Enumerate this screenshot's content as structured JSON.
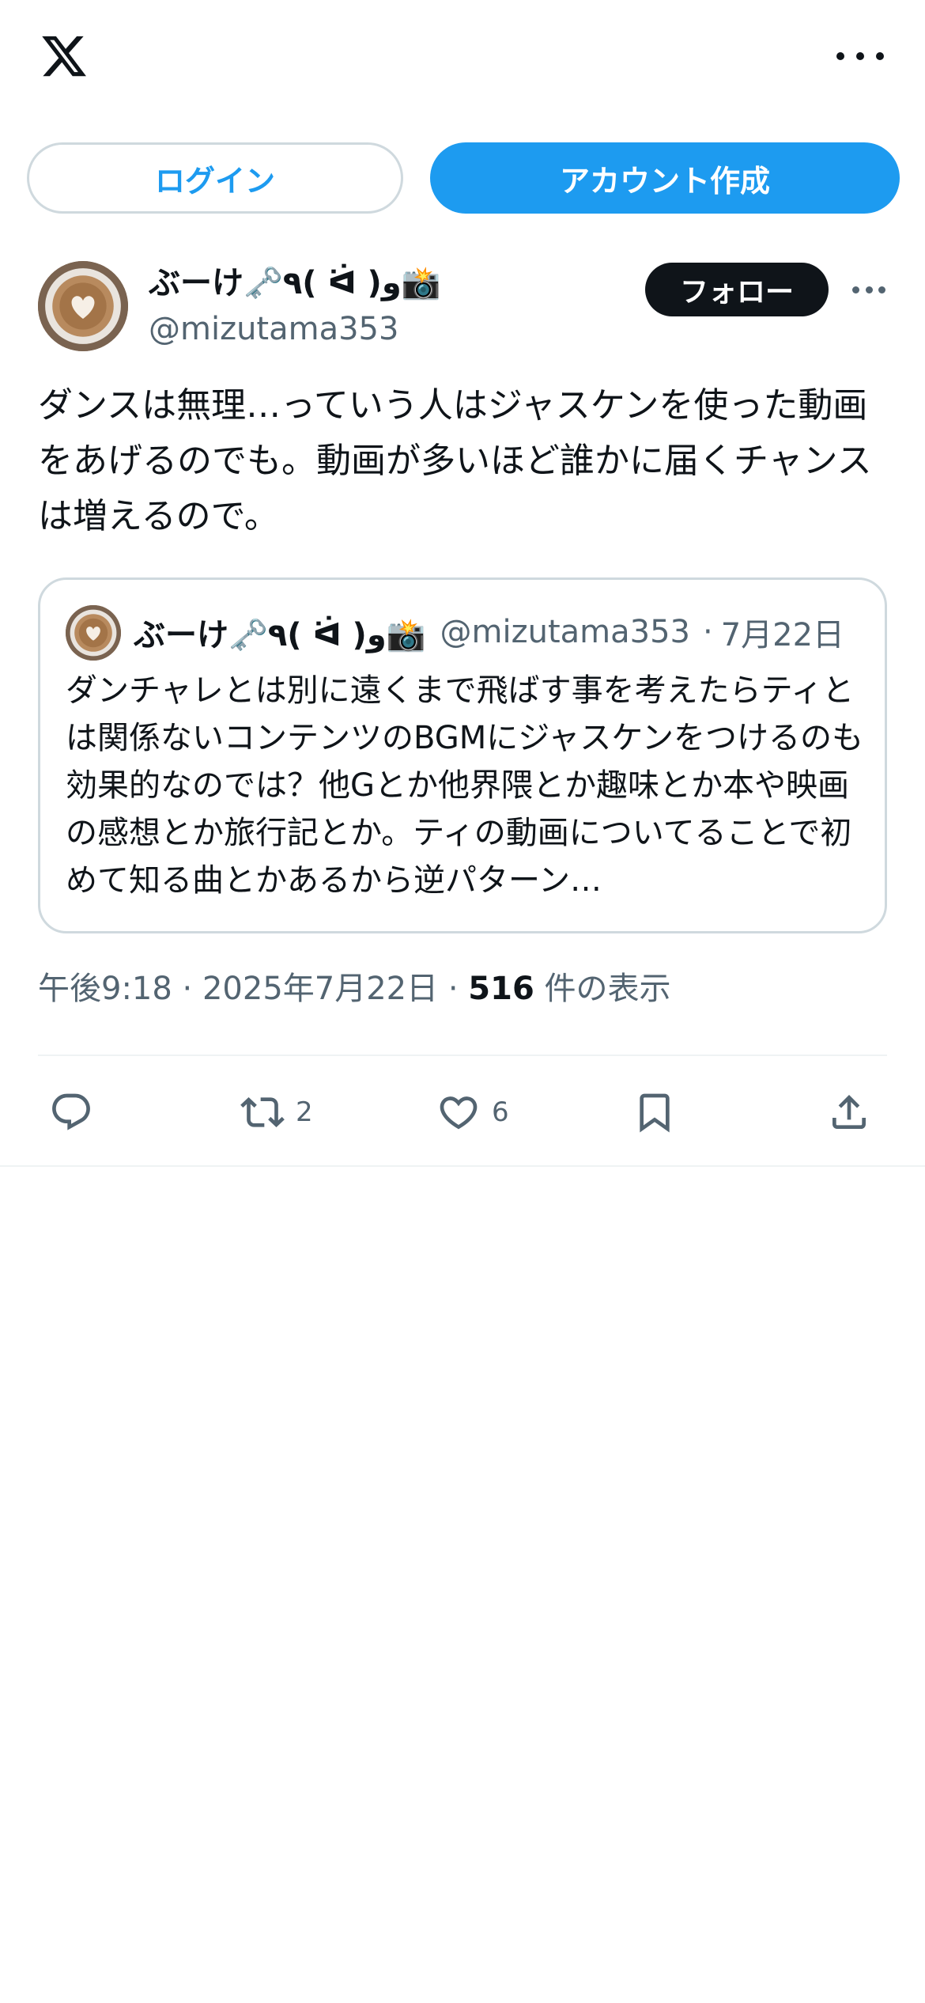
{
  "header": {
    "logo_icon": "x-logo-icon",
    "more_icon": "more-horizontal-icon"
  },
  "auth": {
    "login_label": "ログイン",
    "signup_label": "アカウント作成"
  },
  "tweet": {
    "author_name": "ぶーけ🗝️٩( ᐛ )و📸",
    "author_handle": "@mizutama353",
    "follow_label": "フォロー",
    "text": "ダンスは無理…っていう人はジャスケンを使った動画をあげるのでも。動画が多いほど誰かに届くチャンスは増えるので。",
    "quoted": {
      "author_name": "ぶーけ🗝️٩( ᐛ )و📸",
      "author_handle": "@mizutama353",
      "separator": "·",
      "date": "7月22日",
      "text": "ダンチャレとは別に遠くまで飛ばす事を考えたらティとは関係ないコンテンツのBGMにジャスケンをつけるのも効果的なのでは？他Gとか他界隈とか趣味とか本や映画の感想とか旅行記とか。ティの動画についてることで初めて知る曲とかあるから逆パターン…"
    },
    "meta": {
      "time": "午後9:18",
      "sep1": "·",
      "date": "2025年7月22日",
      "sep2": "·",
      "views_count": "516",
      "views_label": "件の表示"
    },
    "actions": {
      "reply_icon": "reply-icon",
      "retweet_icon": "retweet-icon",
      "retweet_count": "2",
      "like_icon": "heart-icon",
      "like_count": "6",
      "bookmark_icon": "bookmark-icon",
      "share_icon": "share-icon"
    }
  },
  "colors": {
    "accent": "#1d9bf0",
    "text": "#0f1419",
    "secondary": "#536471",
    "border": "#cfd9de"
  }
}
